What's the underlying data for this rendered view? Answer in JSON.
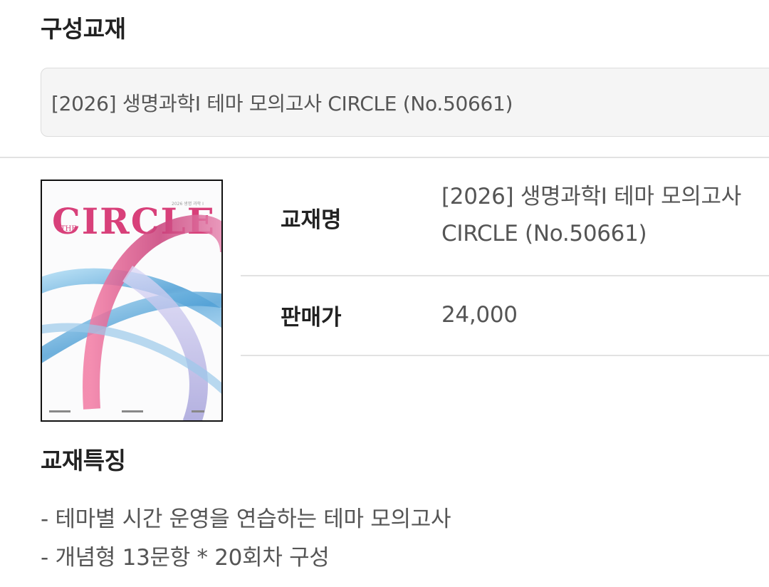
{
  "composition": {
    "title": "구성교재",
    "selected": "[2026] 생명과학I 테마 모의고사 CIRCLE (No.50661)"
  },
  "product": {
    "cover": {
      "brand_small": "THE",
      "brand_title": "CIRCLE",
      "subtitle": "2026 생명 과학 I"
    },
    "name_label": "교재명",
    "name_value": "[2026] 생명과학I 테마 모의고사 CIRCLE (No.50661)",
    "price_label": "판매가",
    "price_value": "24,000"
  },
  "features": {
    "title": "교재특징",
    "items": [
      "- 테마별 시간 운영을 연습하는 테마 모의고사",
      "- 개념형 13문항 * 20회차 구성"
    ]
  },
  "colors": {
    "accent_pink": "#d8407a",
    "ring_blue": "#6fb6e0",
    "ring_lavender": "#b6b4e2"
  }
}
